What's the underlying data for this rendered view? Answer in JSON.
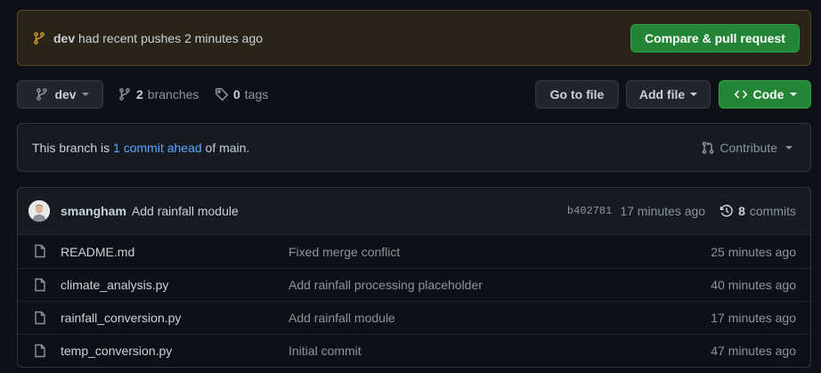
{
  "banner": {
    "branch": "dev",
    "message": "had recent pushes 2 minutes ago",
    "compare_button": "Compare & pull request"
  },
  "toolbar": {
    "branch_name": "dev",
    "branches_count": "2",
    "branches_label": "branches",
    "tags_count": "0",
    "tags_label": "tags",
    "goto_file": "Go to file",
    "add_file": "Add file",
    "code": "Code"
  },
  "ahead": {
    "prefix": "This branch is",
    "link": "1 commit ahead",
    "suffix": "of main.",
    "contribute": "Contribute"
  },
  "latest_commit": {
    "author": "smangham",
    "message": "Add rainfall module",
    "sha": "b402781",
    "time": "17 minutes ago",
    "commit_count": "8",
    "commit_label": "commits"
  },
  "files": [
    {
      "name": "README.md",
      "commit": "Fixed merge conflict",
      "age": "25 minutes ago"
    },
    {
      "name": "climate_analysis.py",
      "commit": "Add rainfall processing placeholder",
      "age": "40 minutes ago"
    },
    {
      "name": "rainfall_conversion.py",
      "commit": "Add rainfall module",
      "age": "17 minutes ago"
    },
    {
      "name": "temp_conversion.py",
      "commit": "Initial commit",
      "age": "47 minutes ago"
    }
  ],
  "colors": {
    "background": "#0d1117",
    "banner_bg": "#2a2418",
    "accent_green": "#238636",
    "link_blue": "#58a6ff",
    "branch_icon": "#d29922"
  },
  "icons": [
    "git-branch-icon",
    "tag-icon",
    "code-icon",
    "pull-request-icon",
    "history-icon",
    "file-icon"
  ]
}
